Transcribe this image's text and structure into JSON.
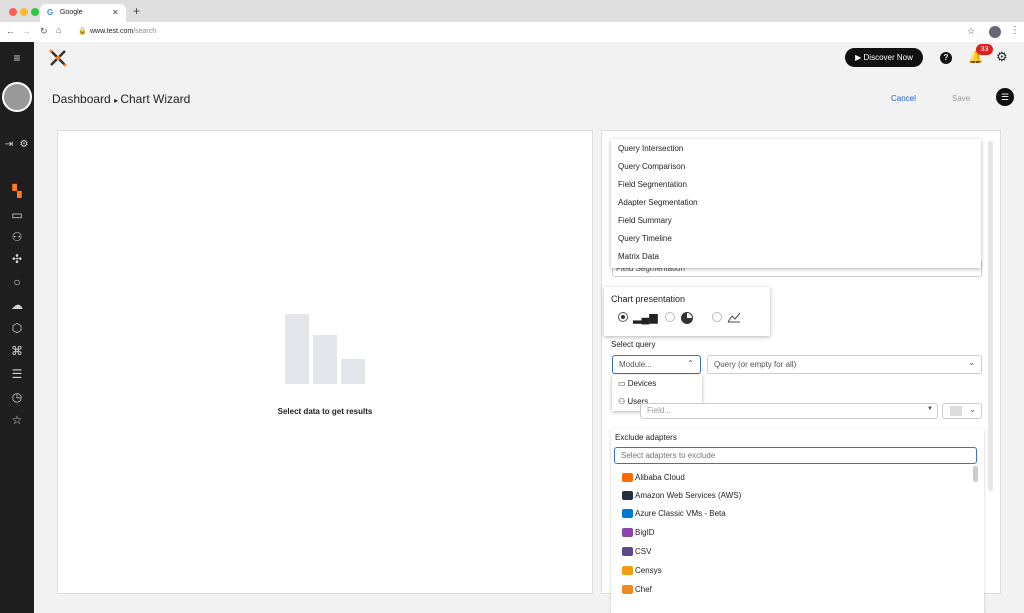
{
  "browser": {
    "tab_title": "Google",
    "url_host": "www.test.com",
    "url_path": "/search"
  },
  "header": {
    "discover_label": "Discover Now",
    "notification_count": "33"
  },
  "page": {
    "breadcrumb_root": "Dashboard",
    "breadcrumb_current": "Chart Wizard",
    "cancel_label": "Cancel",
    "save_label": "Save"
  },
  "canvas": {
    "empty_text": "Select data to get results"
  },
  "chart_type_menu": {
    "items": [
      "Query Intersection",
      "Query Comparison",
      "Field Segmentation",
      "Adapter Segmentation",
      "Field Summary",
      "Query Timeline",
      "Matrix Data"
    ],
    "selected": "Field Segmentation"
  },
  "presentation": {
    "title": "Chart presentation",
    "selected": "bar"
  },
  "query": {
    "label": "Select query",
    "module_placeholder": "Module...",
    "query_placeholder": "Query (or empty for all)",
    "modules": [
      "Devices",
      "Users"
    ],
    "field_placeholder": "Field..."
  },
  "exclude": {
    "label": "Exclude adapters",
    "placeholder": "Select adapters to exclude",
    "adapters": [
      {
        "name": "Alibaba Cloud",
        "color": "#ff6a00"
      },
      {
        "name": "Amazon Web Services (AWS)",
        "color": "#232f3e"
      },
      {
        "name": "Azure Classic VMs - Beta",
        "color": "#0078d4"
      },
      {
        "name": "BigID",
        "color": "#8e44ad"
      },
      {
        "name": "CSV",
        "color": "#5b4a8a"
      },
      {
        "name": "Censys",
        "color": "#f39c12"
      },
      {
        "name": "Chef",
        "color": "#f18b21"
      }
    ]
  }
}
